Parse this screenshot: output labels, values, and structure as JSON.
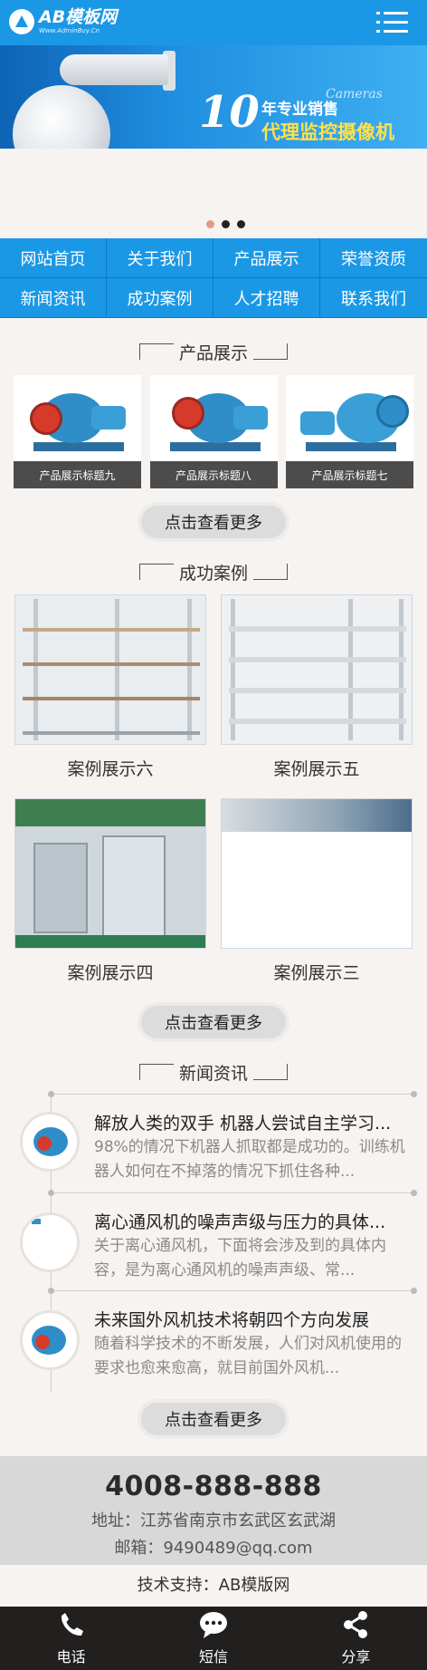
{
  "header": {
    "logo_name": "AB模板网",
    "logo_sub": "Www.AdminBuy.Cn",
    "menu_icon": "menu-icon"
  },
  "banner": {
    "number": "10",
    "line1": "年专业销售",
    "cameras": "Cameras",
    "line2": "代理监控摄像机",
    "slide_count": 3,
    "active_slide": 0
  },
  "nav": {
    "items": [
      {
        "label": "网站首页"
      },
      {
        "label": "关于我们"
      },
      {
        "label": "产品展示"
      },
      {
        "label": "荣誉资质"
      },
      {
        "label": "新闻资讯"
      },
      {
        "label": "成功案例"
      },
      {
        "label": "人才招聘"
      },
      {
        "label": "联系我们"
      }
    ]
  },
  "products": {
    "title": "产品展示",
    "items": [
      {
        "caption": "产品展示标题九"
      },
      {
        "caption": "产品展示标题八"
      },
      {
        "caption": "产品展示标题七"
      }
    ],
    "more_label": "点击查看更多"
  },
  "cases": {
    "title": "成功案例",
    "items": [
      {
        "caption": "案例展示六"
      },
      {
        "caption": "案例展示五"
      },
      {
        "caption": "案例展示四"
      },
      {
        "caption": "案例展示三"
      }
    ],
    "more_label": "点击查看更多"
  },
  "news": {
    "title": "新闻资讯",
    "items": [
      {
        "title": "解放人类的双手 机器人尝试自主学习...",
        "summary": "98%的情况下机器人抓取都是成功的。训练机器人如何在不掉落的情况下抓住各种..."
      },
      {
        "title": "离心通风机的噪声声级与压力的具体...",
        "summary": "关于离心通风机，下面将会涉及到的具体内容，是为离心通风机的噪声声级、常..."
      },
      {
        "title": "未来国外风机技术将朝四个方向发展",
        "summary": "随着科学技术的不断发展，人们对风机使用的要求也愈来愈高，就目前国外风机..."
      }
    ],
    "more_label": "点击查看更多"
  },
  "contact": {
    "phone": "4008-888-888",
    "address": "地址：江苏省南京市玄武区玄武湖",
    "email": "邮箱：9490489@qq.com"
  },
  "support": "技术支持：AB模版网",
  "tabbar": {
    "items": [
      {
        "label": "电话",
        "icon": "phone-icon"
      },
      {
        "label": "短信",
        "icon": "sms-icon"
      },
      {
        "label": "分享",
        "icon": "share-icon"
      }
    ]
  },
  "colors": {
    "primary": "#1a98e6",
    "tabbar": "#221f1f",
    "contact_bg": "#d8d8d8"
  }
}
